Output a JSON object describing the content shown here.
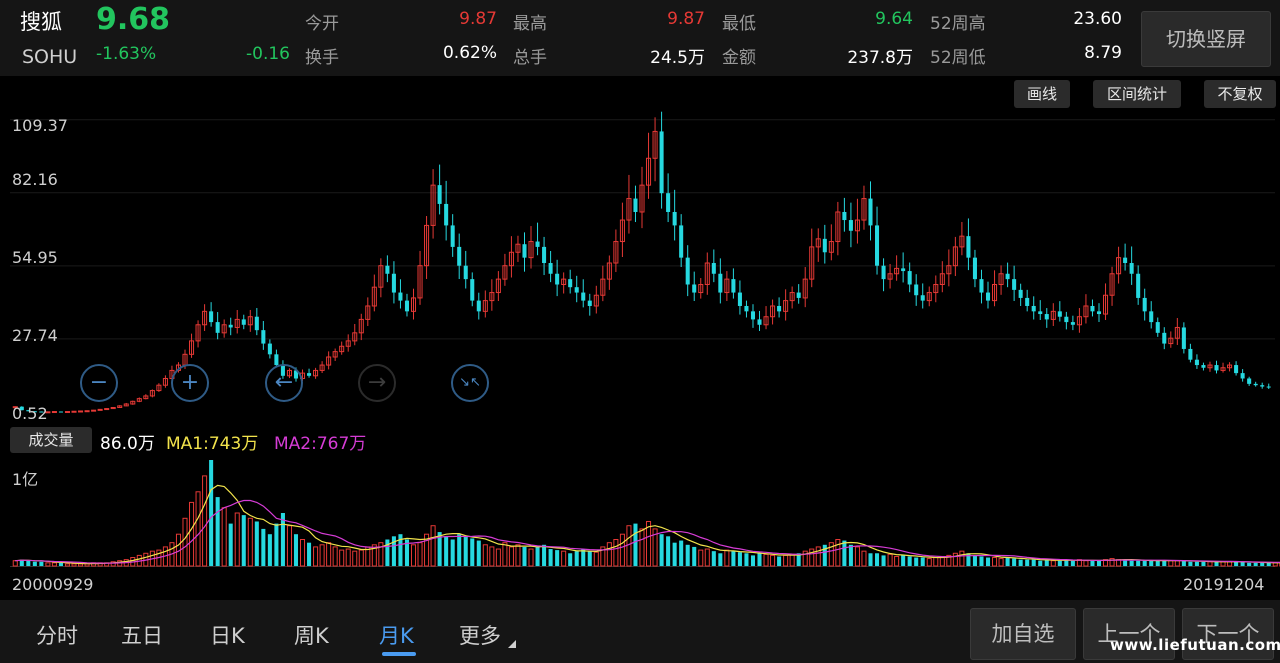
{
  "header": {
    "name": "搜狐",
    "code": "SOHU",
    "price": "9.68",
    "change_pct": "-1.63%",
    "change": "-0.16",
    "stats": [
      {
        "label": "今开",
        "value": "9.87",
        "color": "red"
      },
      {
        "label": "最高",
        "value": "9.87",
        "color": "red"
      },
      {
        "label": "最低",
        "value": "9.64",
        "color": "green"
      },
      {
        "label": "52周高",
        "value": "23.60",
        "color": "white"
      },
      {
        "label": "换手",
        "value": "0.62%",
        "color": "white"
      },
      {
        "label": "总手",
        "value": "24.5万",
        "color": "white"
      },
      {
        "label": "金额",
        "value": "237.8万",
        "color": "white"
      },
      {
        "label": "52周低",
        "value": "8.79",
        "color": "white"
      }
    ],
    "portrait_button": "切换竖屏"
  },
  "toolbar": {
    "draw": "画线",
    "range_stats": "区间统计",
    "no_adjust": "不复权"
  },
  "zoom": {
    "zoom_out": "−",
    "zoom_in": "+",
    "left": "←",
    "right": "→",
    "shrink": "↘↖"
  },
  "volume": {
    "label": "成交量",
    "current": "86.0万",
    "ma1": "MA1:743万",
    "ma2": "MA2:767万",
    "axis_top": "1亿"
  },
  "dates": {
    "start": "20000929",
    "end": "20191204"
  },
  "tabs": [
    "分时",
    "五日",
    "日K",
    "周K",
    "月K",
    "更多"
  ],
  "active_tab": "月K",
  "bottom_buttons": {
    "add": "加自选",
    "prev": "上一个",
    "next": "下一个"
  },
  "watermark": "www.liefutuan.com",
  "colors": {
    "up": "#e53935",
    "down": "#26d9e0",
    "ma1": "#f2e34c",
    "ma2": "#d63cd6",
    "accent": "#4a9bf0"
  },
  "chart_data": [
    {
      "type": "candlestick",
      "title": "",
      "ylabel": "",
      "y_ticks": [
        "109.37",
        "82.16",
        "54.95",
        "27.74",
        "0.52"
      ],
      "ylim": [
        0.52,
        110
      ],
      "x_range": [
        "20000929",
        "20191204"
      ],
      "closes": [
        2.5,
        1.2,
        0.8,
        0.7,
        0.6,
        0.6,
        0.7,
        0.6,
        0.7,
        0.8,
        0.9,
        1.0,
        1.2,
        1.5,
        1.8,
        2.2,
        2.8,
        3.5,
        4.5,
        5.5,
        6.5,
        8.5,
        10.5,
        13.0,
        16.0,
        18.0,
        22.0,
        27.0,
        33.0,
        38.0,
        34.0,
        30.0,
        33.0,
        32.0,
        35.0,
        33.0,
        36.0,
        31.0,
        26.0,
        22.0,
        18.0,
        14.0,
        16.0,
        13.0,
        15.0,
        14.0,
        16.0,
        18.0,
        21.0,
        23.0,
        25.0,
        27.0,
        30.0,
        35.0,
        40.0,
        47.0,
        55.0,
        52.0,
        45.0,
        42.0,
        38.0,
        43.0,
        55.0,
        70.0,
        85.0,
        78.0,
        70.0,
        62.0,
        55.0,
        50.0,
        42.0,
        38.0,
        42.0,
        45.0,
        50.0,
        55.0,
        60.0,
        63.0,
        58.0,
        64.0,
        62.0,
        56.0,
        52.0,
        48.0,
        50.0,
        47.0,
        45.0,
        42.0,
        40.0,
        44.0,
        50.0,
        56.0,
        64.0,
        72.0,
        80.0,
        75.0,
        85.0,
        95.0,
        105.0,
        82.0,
        75.0,
        70.0,
        58.0,
        48.0,
        45.0,
        48.0,
        56.0,
        52.0,
        45.0,
        50.0,
        45.0,
        40.0,
        38.0,
        35.0,
        33.0,
        36.0,
        40.0,
        38.0,
        42.0,
        45.0,
        43.0,
        50.0,
        62.0,
        65.0,
        60.0,
        64.0,
        75.0,
        72.0,
        68.0,
        72.0,
        80.0,
        70.0,
        55.0,
        50.0,
        52.0,
        54.0,
        53.0,
        48.0,
        44.0,
        42.0,
        45.0,
        48.0,
        52.0,
        55.0,
        62.0,
        66.0,
        58.0,
        50.0,
        45.0,
        42.0,
        48.0,
        52.0,
        50.0,
        46.0,
        43.0,
        40.0,
        38.0,
        37.0,
        35.0,
        38.0,
        36.0,
        34.0,
        33.0,
        36.0,
        40.0,
        38.0,
        37.0,
        44.0,
        52.0,
        58.0,
        56.0,
        52.0,
        43.0,
        38.0,
        34.0,
        30.0,
        26.0,
        28.0,
        32.0,
        24.0,
        20.0,
        18.0,
        17.0,
        18.0,
        16.0,
        17.0,
        18.0,
        15.0,
        13.0,
        11.0,
        10.5,
        10.0,
        9.68
      ]
    },
    {
      "type": "bar",
      "title": "",
      "ylabel": "",
      "y_ticks": [
        "1亿"
      ],
      "ylim": [
        0,
        100
      ],
      "values_wan": [
        5,
        6,
        5,
        4,
        4,
        3,
        3,
        3,
        2,
        2,
        2,
        2,
        3,
        3,
        3,
        4,
        5,
        6,
        8,
        10,
        12,
        14,
        15,
        18,
        22,
        30,
        45,
        60,
        70,
        85,
        100,
        65,
        55,
        40,
        50,
        48,
        45,
        42,
        35,
        30,
        40,
        50,
        38,
        30,
        25,
        22,
        18,
        20,
        22,
        18,
        15,
        16,
        14,
        15,
        18,
        20,
        22,
        25,
        28,
        30,
        25,
        20,
        22,
        30,
        38,
        32,
        28,
        25,
        30,
        28,
        26,
        24,
        20,
        18,
        16,
        22,
        18,
        20,
        18,
        16,
        18,
        20,
        16,
        15,
        14,
        12,
        14,
        16,
        14,
        13,
        18,
        22,
        25,
        30,
        38,
        40,
        35,
        42,
        35,
        30,
        28,
        22,
        24,
        20,
        18,
        15,
        16,
        14,
        12,
        15,
        14,
        13,
        12,
        10,
        12,
        11,
        10,
        9,
        10,
        11,
        12,
        14,
        16,
        18,
        20,
        22,
        25,
        24,
        20,
        18,
        14,
        12,
        12,
        10,
        11,
        9,
        10,
        9,
        8,
        8,
        7,
        8,
        9,
        10,
        12,
        14,
        12,
        10,
        9,
        8,
        8,
        7,
        8,
        7,
        6,
        6,
        6,
        5,
        6,
        5,
        5,
        6,
        5,
        6,
        5,
        5,
        5,
        6,
        7,
        6,
        6,
        5,
        5,
        5,
        5,
        5,
        5,
        5,
        5,
        5,
        4,
        4,
        4,
        4,
        4,
        4,
        4,
        4,
        4,
        3,
        3,
        3,
        3,
        3,
        3,
        3,
        3,
        3,
        3
      ],
      "series": [
        {
          "name": "MA1:743万"
        },
        {
          "name": "MA2:767万"
        }
      ]
    }
  ]
}
